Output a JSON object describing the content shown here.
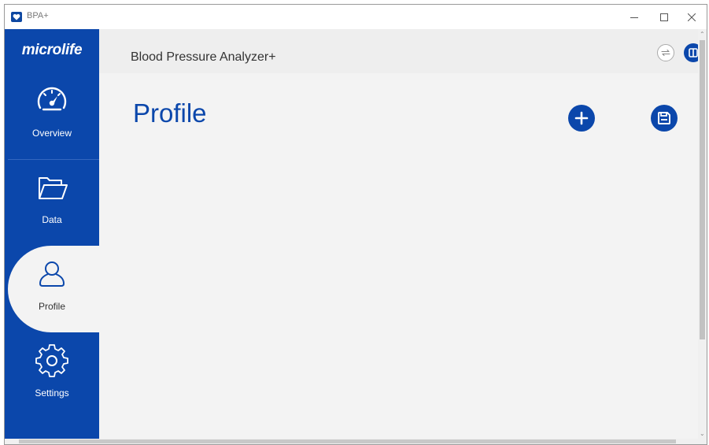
{
  "window": {
    "title": "BPA+"
  },
  "sidebar": {
    "brand": "microlife",
    "items": [
      {
        "label": "Overview",
        "icon": "speedometer-icon"
      },
      {
        "label": "Data",
        "icon": "folder-icon"
      },
      {
        "label": "Profile",
        "icon": "user-icon",
        "active": true
      },
      {
        "label": "Settings",
        "icon": "gear-icon"
      }
    ]
  },
  "header": {
    "app_name": "Blood Pressure Analyzer+"
  },
  "main": {
    "title": "Profile"
  },
  "colors": {
    "brand_blue": "#0b47ab",
    "content_bg": "#f3f3f3"
  }
}
